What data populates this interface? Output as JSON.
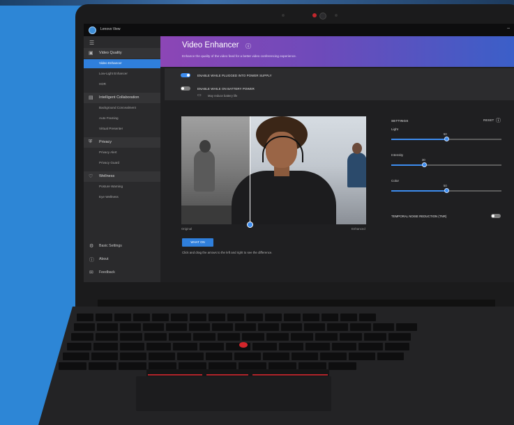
{
  "app": {
    "title": "Lenovo View",
    "window_controls": "–"
  },
  "sidebar": {
    "menu_icon": "☰",
    "sections": [
      {
        "icon": "video-quality-icon",
        "glyph": "▣",
        "label": "Video Quality",
        "items": [
          "Video Enhancer",
          "Low-Light Enhancer",
          "HDR"
        ]
      },
      {
        "icon": "collaboration-icon",
        "glyph": "▤",
        "label": "Intelligent Collaboration",
        "items": [
          "Background Concealment",
          "Auto Framing",
          "Virtual Presenter"
        ]
      },
      {
        "icon": "privacy-icon",
        "glyph": "⛨",
        "label": "Privacy",
        "items": [
          "Privacy Alert",
          "Privacy Guard"
        ]
      },
      {
        "icon": "wellness-icon",
        "glyph": "♡",
        "label": "Wellness",
        "items": [
          "Posture Warning",
          "Eye Wellness"
        ]
      }
    ],
    "bottom": [
      {
        "icon": "gear-icon",
        "glyph": "⚙",
        "label": "Basic Settings"
      },
      {
        "icon": "info-icon",
        "glyph": "ⓘ",
        "label": "About"
      },
      {
        "icon": "feedback-icon",
        "glyph": "✉",
        "label": "Feedback"
      }
    ]
  },
  "hero": {
    "title": "Video Enhancer",
    "info_glyph": "ⓘ",
    "subtitle": "Enhance the quality of the video feed for a better video conferencing experience."
  },
  "toggles": {
    "plugged": {
      "label": "ENABLE WHILE PLUGGED INTO POWER SUPPLY",
      "on": true
    },
    "battery": {
      "label": "ENABLE WHILE ON BATTERY POWER",
      "on": false
    },
    "battery_note": "May reduce battery life"
  },
  "preview": {
    "original_label": "Original",
    "enhanced_label": "Enhanced",
    "button_label": "WHAT ON",
    "hint": "Click and drag the arrows to the left and right to see the difference."
  },
  "settings": {
    "title": "SETTINGS",
    "reset_label": "RESET",
    "sliders": [
      {
        "label": "Light",
        "value": "50",
        "fraction": 0.5
      },
      {
        "label": "Intensity",
        "value": "30",
        "fraction": 0.3
      },
      {
        "label": "Color",
        "value": "50",
        "fraction": 0.5
      }
    ],
    "temporal_noise": {
      "label": "TEMPORAL NOISE REDUCTION (TNR)",
      "on": false
    }
  },
  "colors": {
    "accent": "#2f7fdc",
    "desk_bg": "#2d86d6",
    "trackpoint": "#d4252b"
  }
}
